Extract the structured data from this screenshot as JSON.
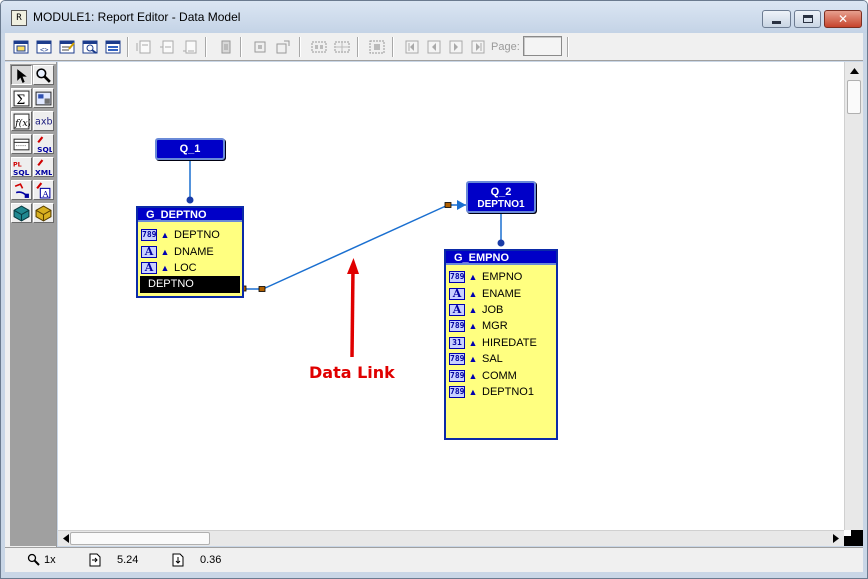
{
  "window": {
    "title": "MODULE1: Report Editor - Data Model",
    "icon": "report-editor-icon",
    "controls": {
      "minimize": "minimize-icon",
      "maximize": "maximize-icon",
      "close": "close-icon"
    }
  },
  "toolbar": {
    "buttons": [
      "data-model-view-icon",
      "web-source-view-icon",
      "paper-layout-view-icon",
      "paper-design-view-icon",
      "parameter-form-view-icon",
      "insert-field-icon",
      "insert-page-break-icon",
      "insert-page-number-icon",
      "move-forward-icon",
      "align-icon",
      "resize-icon",
      "group-icon",
      "ungroup-icon",
      "select-parent-frame-icon",
      "first-page-icon",
      "previous-page-icon",
      "next-page-icon",
      "last-page-icon"
    ],
    "page_label": "Page:",
    "page_value": ""
  },
  "palette": {
    "tools": [
      "select-icon",
      "magnify-icon",
      "summary-column-icon",
      "placeholder-column-icon",
      "formula-column-icon",
      "cross-product-icon",
      "ref-cursor-query-icon",
      "sql-query-icon",
      "plsql-query-icon",
      "xml-query-icon",
      "data-link-icon",
      "text-query-icon",
      "express-query-icon",
      "jdbc-query-icon"
    ]
  },
  "canvas": {
    "query1": {
      "label": "Q_1"
    },
    "group1": {
      "title": "G_DEPTNO",
      "columns": [
        {
          "name": "DEPTNO",
          "type": "number",
          "icon_text": "789"
        },
        {
          "name": "DNAME",
          "type": "char",
          "icon_text": "A"
        },
        {
          "name": "LOC",
          "type": "char",
          "icon_text": "A"
        }
      ],
      "selected_column": "DEPTNO"
    },
    "query2": {
      "label": "Q_2",
      "link_column": "DEPTNO1"
    },
    "group2": {
      "title": "G_EMPNO",
      "columns": [
        {
          "name": "EMPNO",
          "type": "number",
          "icon_text": "789"
        },
        {
          "name": "ENAME",
          "type": "char",
          "icon_text": "A"
        },
        {
          "name": "JOB",
          "type": "char",
          "icon_text": "A"
        },
        {
          "name": "MGR",
          "type": "number",
          "icon_text": "789"
        },
        {
          "name": "HIREDATE",
          "type": "date",
          "icon_text": "31"
        },
        {
          "name": "SAL",
          "type": "number",
          "icon_text": "789"
        },
        {
          "name": "COMM",
          "type": "number",
          "icon_text": "789"
        },
        {
          "name": "DEPTNO1",
          "type": "number",
          "icon_text": "789"
        }
      ]
    },
    "annotation": {
      "label": "Data Link",
      "color": "#e00000"
    }
  },
  "status": {
    "zoom": "1x",
    "position_x": "5.24",
    "position_y": "0.36"
  },
  "colors": {
    "query_fill": "#0000c8",
    "group_fill": "#ffff80",
    "link_line": "#1a6fd0"
  }
}
